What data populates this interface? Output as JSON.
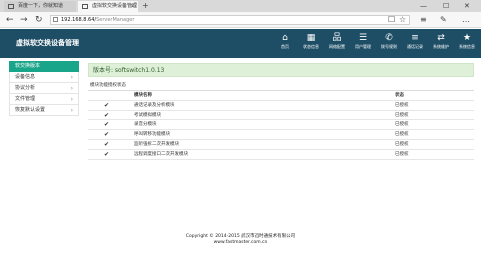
{
  "browser": {
    "tabs": [
      {
        "label": "百度一下，你就知道"
      },
      {
        "label": "虚拟软交换设备管理"
      }
    ],
    "new_tab": "+",
    "controls": {
      "minimize": "—",
      "maximize": "☐",
      "close": "✕"
    },
    "nav": {
      "back": "←",
      "forward": "→",
      "reload": "↻"
    },
    "url_host": "192.168.8.64/",
    "url_path": "ServerManager",
    "right_icons": {
      "reader": "☐",
      "favorite": "☆",
      "hub": "≡",
      "note": "✎",
      "more": "…"
    }
  },
  "header": {
    "title": "虚拟软交换设备管理",
    "nav": [
      {
        "label": "首页",
        "icon": "⌂"
      },
      {
        "label": "状态信息",
        "icon": "▦"
      },
      {
        "label": "网络配置",
        "icon": "品"
      },
      {
        "label": "用户管理",
        "icon": "☰"
      },
      {
        "label": "拨号规则",
        "icon": "✆"
      },
      {
        "label": "通话记录",
        "icon": "≡"
      },
      {
        "label": "系统维护",
        "icon": "⇄"
      },
      {
        "label": "系统信息",
        "icon": "★"
      }
    ]
  },
  "sidebar": {
    "items": [
      {
        "label": "软交换版本",
        "active": true
      },
      {
        "label": "设备信息",
        "chevron": "›"
      },
      {
        "label": "协议分析",
        "chevron": "›"
      },
      {
        "label": "文件管理",
        "chevron": "›"
      },
      {
        "label": "恢复默认设置",
        "chevron": "›"
      }
    ]
  },
  "main": {
    "version": "版本号: softswitch1.0.13",
    "section_title": "模块功能授权状态",
    "columns": {
      "name": "模块名称",
      "status": "状态"
    },
    "rows": [
      {
        "check": "✔",
        "name": "通话记录及分析模块",
        "status": "已授权"
      },
      {
        "check": "✔",
        "name": "考试模拟模块",
        "status": "已授权"
      },
      {
        "check": "✔",
        "name": "录音分模块",
        "status": "已授权"
      },
      {
        "check": "✔",
        "name": "呼叫转移功能模块",
        "status": "已授权"
      },
      {
        "check": "✔",
        "name": "监听强拆二次开发模块",
        "status": "已授权"
      },
      {
        "check": "✔",
        "name": "远程调度接口二次开发模块",
        "status": "已授权"
      }
    ]
  },
  "footer": {
    "copyright": "Copyright © 2014-2015 武汉市迅时通技术有限公司",
    "website": "www.fastmaster.com.cn"
  }
}
